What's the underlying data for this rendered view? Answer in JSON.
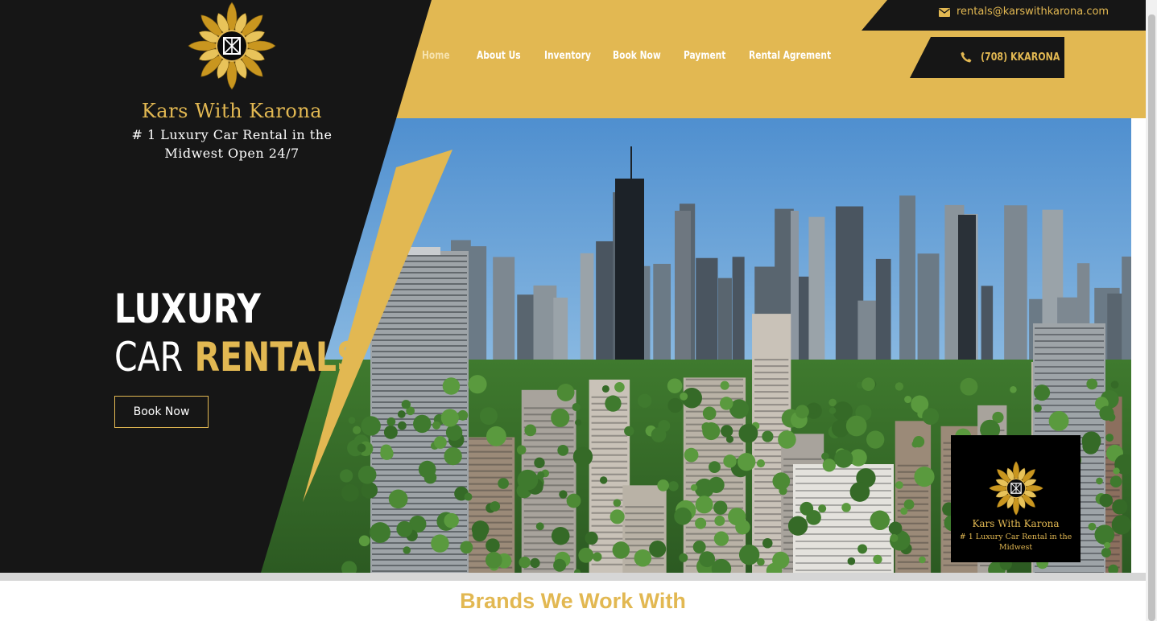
{
  "brand": {
    "name": "Kars With Karona",
    "tagline": "# 1 Luxury Car Rental in the Midwest Open 24/7"
  },
  "nav": {
    "items": [
      "Home",
      "About Us",
      "Inventory",
      "Book Now",
      "Payment",
      "Rental Agrement"
    ],
    "active": "Home"
  },
  "contact": {
    "email": "rentals@karswithkarona.com",
    "phone": "(708) KKARONA"
  },
  "hero": {
    "line1": "LUXURY",
    "line2_plain": "CAR",
    "line2_accent": "RENTALS",
    "cta_label": "Book Now"
  },
  "overlay_card": {
    "title": "Kars With Karona",
    "tagline": "# 1 Luxury Car Rental in the Midwest"
  },
  "brands_section": {
    "title": "Brands We Work With"
  },
  "icons": {
    "logo": "ornate-sunflower-monogram-logo",
    "email": "envelope-icon",
    "phone": "phone-icon"
  },
  "colors": {
    "gold": "#e2b852",
    "black": "#161616",
    "white": "#ffffff"
  }
}
